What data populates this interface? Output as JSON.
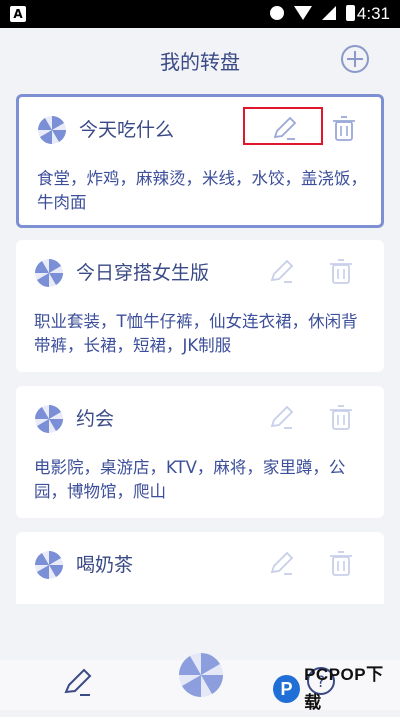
{
  "status_bar": {
    "time": "4:31",
    "notification_letter": "A"
  },
  "header": {
    "title": "我的转盘"
  },
  "cards": [
    {
      "name": "今天吃什么",
      "items": "食堂，炸鸡，麻辣烫，米线，水饺，盖浇饭，牛肉面",
      "active": true
    },
    {
      "name": "今日穿搭女生版",
      "items": "职业套装，T恤牛仔裤，仙女连衣裙，休闲背带裤，长裙，短裙，JK制服",
      "active": false
    },
    {
      "name": "约会",
      "items": "电影院，桌游店，KTV，麻将，家里蹲，公园，博物馆，爬山",
      "active": false
    },
    {
      "name": "喝奶茶",
      "items": "",
      "active": false
    }
  ],
  "watermark": {
    "text": "PCPOP下载",
    "logo_letter": "P"
  },
  "colors": {
    "accent": "#3a4a86",
    "wheel": "#7b8fd6",
    "highlight": "#e0162b"
  },
  "icons": [
    "add-icon",
    "wheel-icon",
    "edit-icon",
    "trash-icon",
    "pen-icon",
    "help-icon"
  ]
}
